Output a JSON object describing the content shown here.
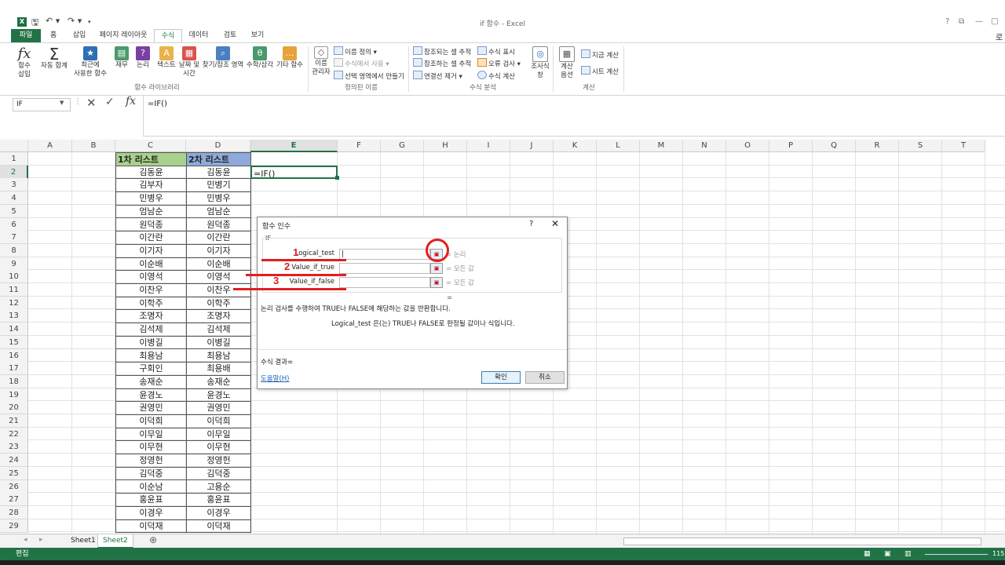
{
  "window": {
    "title": "if 함수 - Excel",
    "controls": [
      "?",
      "⧉",
      "—",
      "□"
    ],
    "user": "로"
  },
  "quick_access": {
    "save": "🖫",
    "undo": "↶ ▾",
    "redo": "↷ ▾",
    "customize": "▾"
  },
  "tabs": [
    "파일",
    "홈",
    "삽입",
    "페이지 레이아웃",
    "수식",
    "데이터",
    "검토",
    "보기"
  ],
  "active_tab": "수식",
  "ribbon": {
    "insert_function": {
      "icon": "fx",
      "label": "함수\n삽입"
    },
    "autosum": {
      "label": "자동 합계"
    },
    "recent": {
      "label": "최근에\n사용한 함수"
    },
    "financial": {
      "label": "재무"
    },
    "logical": {
      "label": "논리"
    },
    "text": {
      "label": "텍스트"
    },
    "datetime": {
      "label": "날짜 및\n시간"
    },
    "lookup": {
      "label": "찾기/참조 영역"
    },
    "math": {
      "label": "수학/삼각"
    },
    "more": {
      "label": "기타 함수"
    },
    "group_library": "함수 라이브러리",
    "name_manager": {
      "label": "이름\n관리자"
    },
    "define_name": "이름 정의",
    "use_in_formula": "수식에서 사용",
    "create_from_selection": "선택 영역에서 만들기",
    "group_names": "정의된 이름",
    "trace_precedents": "참조되는 셀 추적",
    "trace_dependents": "참조하는 셀 추적",
    "remove_arrows": "연결선 제거",
    "show_formulas": "수식 표시",
    "error_checking": "오류 검사",
    "evaluate_formula": "수식 계산",
    "watch_window": {
      "label": "조사식\n창"
    },
    "group_audit": "수식 분석",
    "calc_options": {
      "label": "계산\n옵션"
    },
    "calc_now": "지금 계산",
    "calc_sheet": "시트 계산",
    "group_calc": "계산"
  },
  "formula_bar": {
    "name_box": "IF",
    "formula": "=IF()",
    "fx": "fx"
  },
  "columns": [
    "A",
    "B",
    "C",
    "D",
    "E",
    "F",
    "G",
    "H",
    "I",
    "J",
    "K",
    "L",
    "M",
    "N",
    "O",
    "P",
    "Q",
    "R",
    "S",
    "T"
  ],
  "selected_column": "E",
  "rows": [
    1,
    2,
    3,
    4,
    5,
    6,
    7,
    8,
    9,
    10,
    11,
    12,
    13,
    14,
    15,
    16,
    17,
    18,
    19,
    20,
    21,
    22,
    23,
    24,
    25,
    26,
    27,
    28,
    29
  ],
  "selected_row": 2,
  "table": {
    "header_c": "1차 리스트",
    "header_d": "2차 리스트",
    "list1": [
      "김동윤",
      "김부자",
      "민병우",
      "엄남순",
      "원덕종",
      "이간란",
      "이기자",
      "이순배",
      "이영석",
      "이찬우",
      "이학주",
      "조명자",
      "김석제",
      "이병길",
      "최용남",
      "구회인",
      "송재순",
      "윤경노",
      "권영민",
      "이덕희",
      "이무일",
      "이무현",
      "정영헌",
      "김덕중",
      "이순남",
      "홍윤표",
      "이경우",
      "이덕재"
    ],
    "list2": [
      "김동윤",
      "민병기",
      "민병우",
      "엄남순",
      "원덕종",
      "이간란",
      "이기자",
      "이순배",
      "이영석",
      "이찬우",
      "이학주",
      "조명자",
      "김석제",
      "이병길",
      "최용남",
      "최용배",
      "송재순",
      "윤경노",
      "권영민",
      "이덕희",
      "이무일",
      "이무현",
      "정영헌",
      "김덕중",
      "고용순",
      "홍윤표",
      "이경우",
      "이덕재"
    ],
    "active_cell": "=IF()"
  },
  "dialog": {
    "title": "함수 인수",
    "help_button": "?",
    "close_button": "✕",
    "function_name": "IF",
    "args": [
      {
        "label": "Logical_test",
        "result": "= 논리"
      },
      {
        "label": "Value_if_true",
        "result": "= 모든 값"
      },
      {
        "label": "Value_if_false",
        "result": "= 모든 값"
      }
    ],
    "equals": "=",
    "description": "논리 검사를 수행하여 TRUE나 FALSE에 해당하는 값을 반환합니다.",
    "arg_description": "Logical_test  은(는) TRUE나 FALSE로 판정될 값이나 식입니다.",
    "formula_result": "수식 결과=",
    "help_link": "도움말(H)",
    "ok": "확인",
    "cancel": "취소"
  },
  "annotations": {
    "num1": "1",
    "num2": "2",
    "num3": "3",
    "color": "#e02020"
  },
  "sheets": [
    "Sheet1",
    "Sheet2"
  ],
  "active_sheet": "Sheet2",
  "add_sheet": "⊕",
  "status": {
    "mode": "편집",
    "zoom": "115"
  },
  "colors": {
    "excel_green": "#217346",
    "header_green": "#a9d18e",
    "header_blue": "#8eaadb"
  }
}
